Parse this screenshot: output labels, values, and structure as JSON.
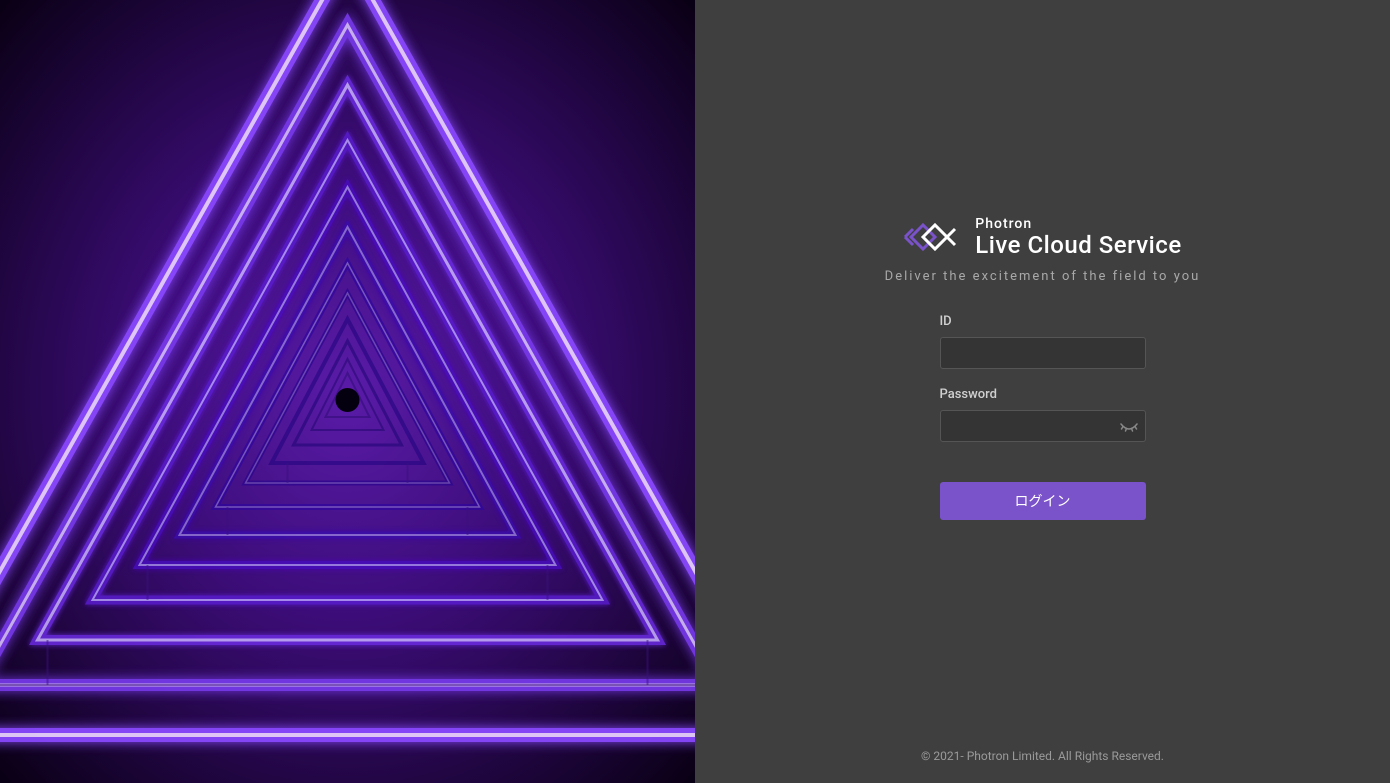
{
  "logo": {
    "brand": "Photron",
    "title": "Live Cloud Service"
  },
  "tagline": "Deliver the excitement of the field to you",
  "form": {
    "id_label": "ID",
    "id_value": "",
    "password_label": "Password",
    "password_value": "",
    "login_button": "ログイン"
  },
  "footer": {
    "copyright": "© 2021- Photron Limited. All Rights Reserved."
  },
  "colors": {
    "accent": "#7a52c9",
    "background_dark": "#3f3f3f",
    "input_bg": "#343434"
  }
}
